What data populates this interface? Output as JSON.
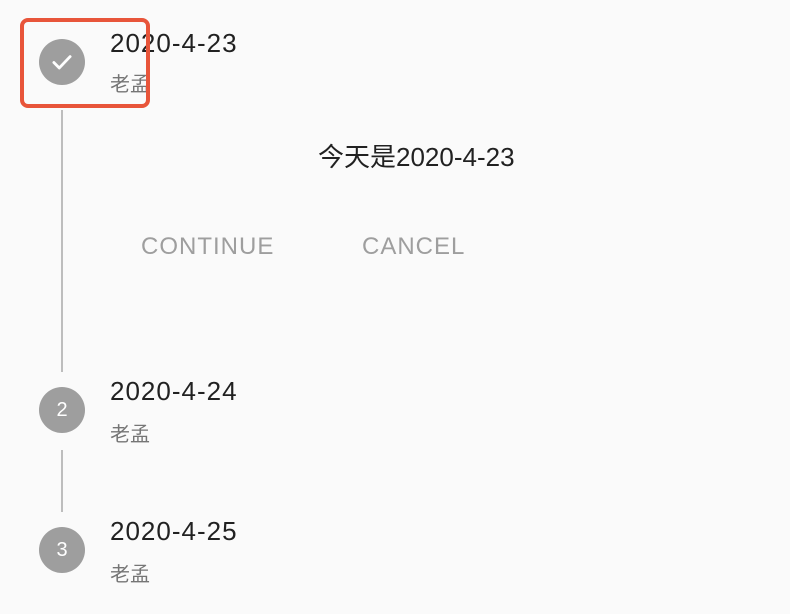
{
  "colors": {
    "background": "#fafafa",
    "step_circle": "#9e9e9e",
    "connector": "#bdbdbd",
    "title_text": "#212121",
    "subtitle_text": "#757575",
    "button_text": "#9e9e9e",
    "highlight": "#e8553a"
  },
  "steps": [
    {
      "indicator_icon": "check-icon",
      "title": "2020-4-23",
      "subtitle": "老孟",
      "state": "active",
      "content": "今天是2020-4-23",
      "controls": {
        "continue_label": "CONTINUE",
        "cancel_label": "CANCEL"
      }
    },
    {
      "indicator": "2",
      "title": "2020-4-24",
      "subtitle": "老孟",
      "state": "pending"
    },
    {
      "indicator": "3",
      "title": "2020-4-25",
      "subtitle": "老孟",
      "state": "pending"
    }
  ]
}
